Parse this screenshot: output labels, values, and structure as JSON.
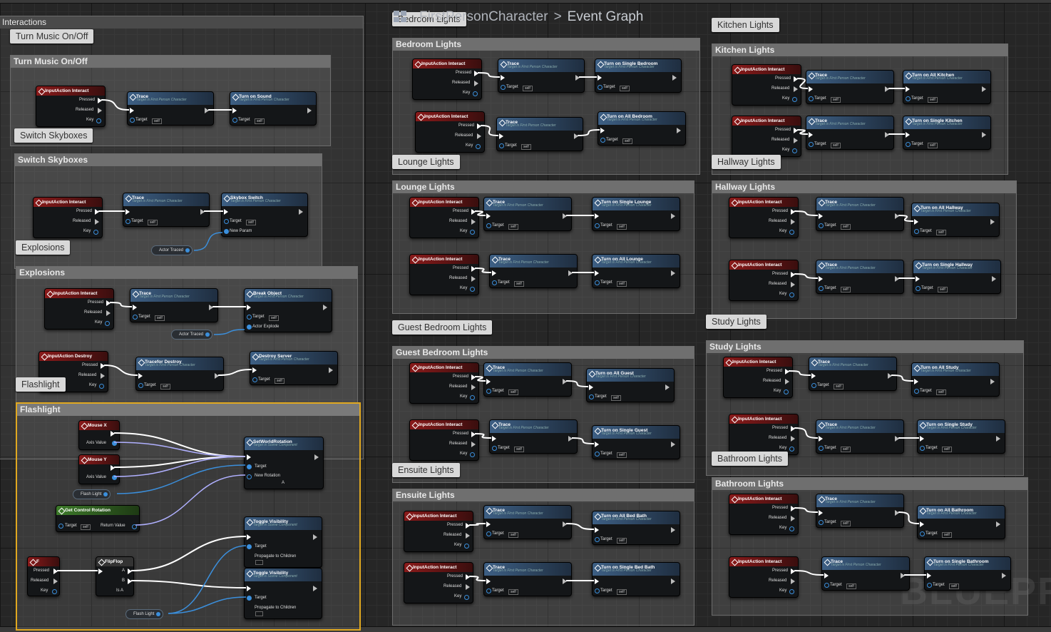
{
  "breadcrumb": {
    "asset": "FirstPersonCharacter",
    "graph": "Event Graph"
  },
  "top_left_label": "Interactions",
  "watermark": "BLUEPRI",
  "colors": {
    "exec": "#ffffff",
    "object_wire": "#3b8fdc",
    "float_wire": "#b0b0ff",
    "event_header": "#8a1a1a",
    "function_header": "#3d5f84",
    "pure_header": "#3d7a2a",
    "selected_border": "#e0a820"
  },
  "comments": [
    {
      "id": "music",
      "bubble": "Turn Music On/Off",
      "title": "Turn Music On/Off"
    },
    {
      "id": "sky",
      "bubble": "Switch Skyboxes",
      "title": "Switch Skyboxes"
    },
    {
      "id": "expl",
      "bubble": "Explosions",
      "title": "Explosions"
    },
    {
      "id": "flash",
      "bubble": "Flashlight",
      "title": "Flashlight"
    },
    {
      "id": "bed",
      "bubble": "Bedroom Lights",
      "title": "Bedroom Lights"
    },
    {
      "id": "lounge",
      "bubble": "Lounge Lights",
      "title": "Lounge Lights"
    },
    {
      "id": "guest",
      "bubble": "Guest Bedroom Lights",
      "title": "Guest Bedroom Lights"
    },
    {
      "id": "ensuite",
      "bubble": "Ensuite Lights",
      "title": "Ensuite Lights"
    },
    {
      "id": "kitchen",
      "bubble": "Kitchen Lights",
      "title": "Kitchen Lights"
    },
    {
      "id": "hall",
      "bubble": "Hallway Lights",
      "title": "Hallway Lights"
    },
    {
      "id": "study",
      "bubble": "Study Lights",
      "title": "Study Lights"
    },
    {
      "id": "bath",
      "bubble": "Bathroom Lights",
      "title": "Bathroom Lights"
    }
  ],
  "pins": {
    "pressed": "Pressed",
    "released": "Released",
    "key": "Key",
    "target": "Target",
    "self": "self",
    "new_param": "New Param",
    "actor_explode": "Actor Explode",
    "axis_value": "Axis Value",
    "new_rotation": "New Rotation",
    "return_value": "Return Value",
    "propagate": "Propagate to Children",
    "a": "A",
    "b": "B",
    "is_a": "Is A"
  },
  "subtitles": {
    "fpc": "Target is First Person Character",
    "comp": "Target is Scene Component",
    "pawn": "Target is Pawn"
  },
  "node_titles": {
    "input_interact": "InputAction Interact",
    "input_destroy": "InputAction Destroy",
    "trace": "Trace",
    "tracefor_destroy": "Tracefor Destroy",
    "turn_on_sound": "Turn on Sound",
    "skybox_switch": "Skybox Switch",
    "break_object": "Break Object",
    "destroy_server": "Destroy Server",
    "mouse_x": "Mouse X",
    "mouse_y": "Mouse Y",
    "set_world_rotation": "SetWorldRotation",
    "get_control_rotation": "Get Control Rotation",
    "toggle_visibility": "Toggle Visibility",
    "key_f": "F",
    "flipflop": "FlipFlop",
    "single_bedroom": "Turn on Single Bedroom",
    "all_bedroom": "Turn on All Bedroom",
    "single_lounge": "Turn on Single Lounge",
    "all_lounge": "Turn on All Lounge",
    "all_guest": "Turn on All Guest",
    "single_guest": "Turn on Single Guest",
    "all_bedbath": "Turn on All Bed Bath",
    "single_bedbath": "Turn on Single Bed Bath",
    "all_kitchen": "Turn on All Kitchen",
    "single_kitchen": "Turn on Single Kitchen",
    "single_hallway": "Turn on Single Hallway",
    "all_hallway": "Turn on All Hallway",
    "all_study": "Turn on All Study",
    "single_study": "Turn on Single Study",
    "all_bathroom": "Turn on All Bathroom",
    "single_bathroom": "Turn on Single Bathroom"
  },
  "variables": {
    "actor_traced": "Actor Traced",
    "flash_light": "Flash Light"
  }
}
